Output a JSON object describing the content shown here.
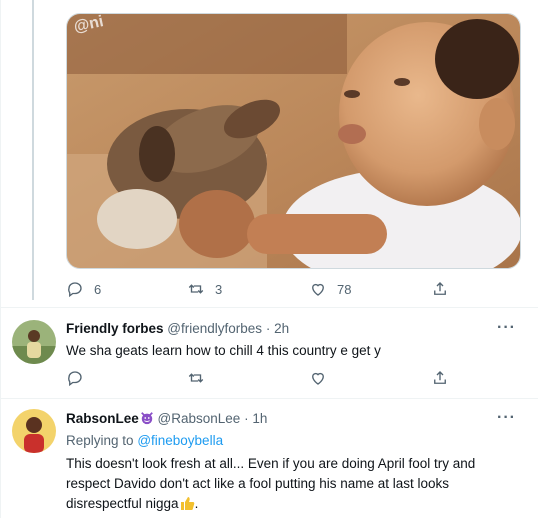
{
  "top_tweet": {
    "media": {
      "watermark": "@ni",
      "alt": "baby holding puppy photo"
    },
    "actions": {
      "reply_count": "6",
      "retweet_count": "3",
      "like_count": "78"
    }
  },
  "reply1": {
    "name": "Friendly forbes",
    "handle": "@friendlyforbes",
    "separator": "·",
    "time": "2h",
    "more": "···",
    "text": "We sha geats learn how to chill 4 this country e get y"
  },
  "reply2": {
    "name": "RabsonLee",
    "name_emoji": "smiling-devil-icon",
    "handle": "@RabsonLee",
    "separator": "·",
    "time": "1h",
    "more": "···",
    "replying_prefix": "Replying to",
    "replying_to": "@fineboybella",
    "text_line1": "This doesn't look fresh at all... Even if you are doing April fool try and",
    "text_line2": "respect Davido don't act like a fool putting his name at last looks",
    "text_line3": "disrespectful nigga",
    "text_emoji": "thumbs-up-icon"
  },
  "colors": {
    "text": "#0f1419",
    "secondary": "#536471",
    "link": "#1d9bf0",
    "border": "#eff3f4"
  }
}
